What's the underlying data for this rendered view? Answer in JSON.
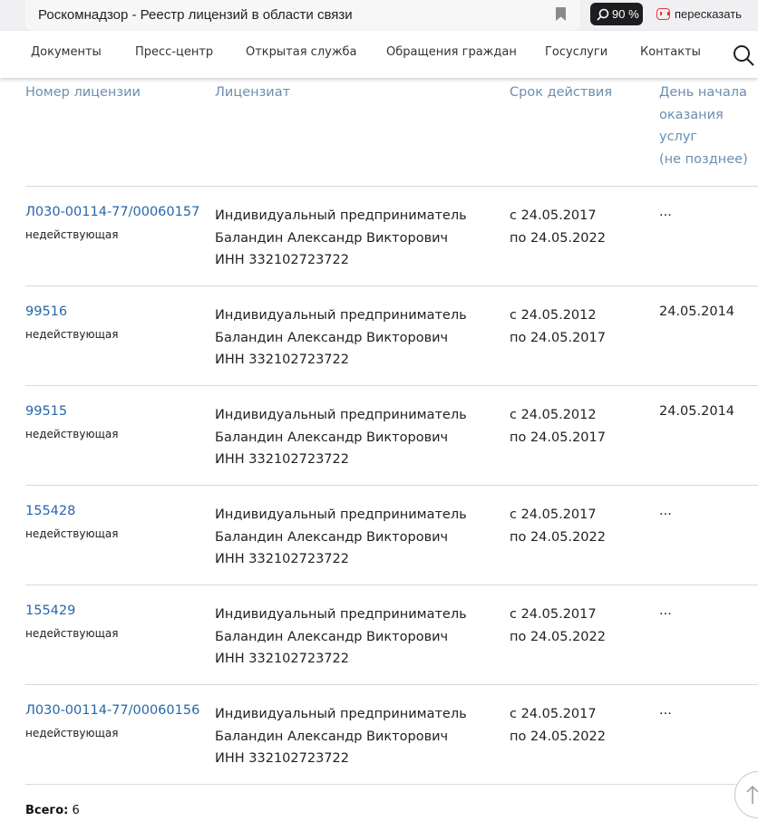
{
  "browser": {
    "tab_title": "Роскомнадзор - Реестр лицензий в области связи",
    "zoom_label": "90 %",
    "retell_label": "пересказать",
    "icons": [
      "bookmark-icon",
      "zoom-search-icon",
      "yandex-retell-icon"
    ]
  },
  "nav": {
    "items": [
      "Документы",
      "Пресс-центр",
      "Открытая служба",
      "Обращения граждан",
      "Госуслуги",
      "Контакты"
    ]
  },
  "table": {
    "headers": {
      "number": "Номер лицензии",
      "licensee": "Лицензиат",
      "term": "Срок действия",
      "start": [
        "День начала",
        "оказания",
        "услуг",
        "(не позднее)"
      ]
    },
    "rows": [
      {
        "number": "Л030-00114-77/00060157",
        "status": "недействующая",
        "licensee": [
          "Индивидуальный предприниматель",
          "Баландин Александр Викторович",
          "ИНН 332102723722"
        ],
        "term": [
          "с 24.05.2017",
          "по 24.05.2022"
        ],
        "start": "..."
      },
      {
        "number": "99516",
        "status": "недействующая",
        "licensee": [
          "Индивидуальный предприниматель",
          "Баландин Александр Викторович",
          "ИНН 332102723722"
        ],
        "term": [
          "с 24.05.2012",
          "по 24.05.2017"
        ],
        "start": "24.05.2014"
      },
      {
        "number": "99515",
        "status": "недействующая",
        "licensee": [
          "Индивидуальный предприниматель",
          "Баландин Александр Викторович",
          "ИНН 332102723722"
        ],
        "term": [
          "с 24.05.2012",
          "по 24.05.2017"
        ],
        "start": "24.05.2014"
      },
      {
        "number": "155428",
        "status": "недействующая",
        "licensee": [
          "Индивидуальный предприниматель",
          "Баландин Александр Викторович",
          "ИНН 332102723722"
        ],
        "term": [
          "с 24.05.2017",
          "по 24.05.2022"
        ],
        "start": "..."
      },
      {
        "number": "155429",
        "status": "недействующая",
        "licensee": [
          "Индивидуальный предприниматель",
          "Баландин Александр Викторович",
          "ИНН 332102723722"
        ],
        "term": [
          "с 24.05.2017",
          "по 24.05.2022"
        ],
        "start": "..."
      },
      {
        "number": "Л030-00114-77/00060156",
        "status": "недействующая",
        "licensee": [
          "Индивидуальный предприниматель",
          "Баландин Александр Викторович",
          "ИНН 332102723722"
        ],
        "term": [
          "с 24.05.2017",
          "по 24.05.2022"
        ],
        "start": "..."
      }
    ]
  },
  "total": {
    "label": "Всего:",
    "value": "6"
  },
  "colors": {
    "link": "#2767a8",
    "header_text": "#6c8eb0",
    "divider": "#d9d9d9"
  }
}
